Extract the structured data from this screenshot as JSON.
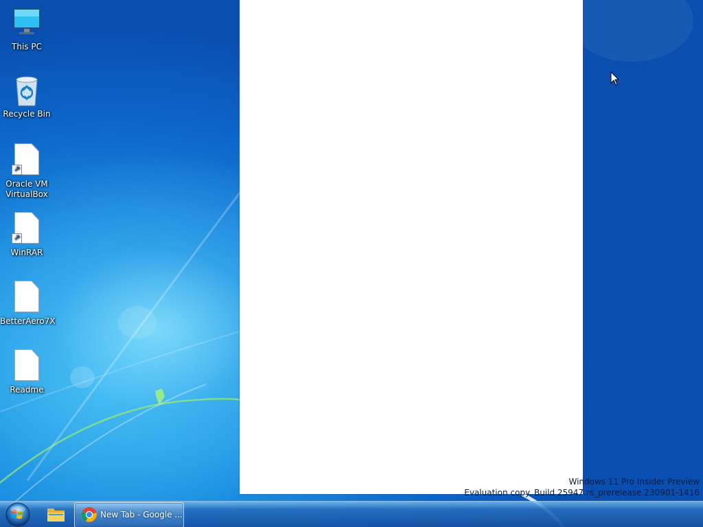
{
  "desktop": {
    "icons": [
      {
        "label": "This PC",
        "icon": "monitor-icon"
      },
      {
        "label": "Recycle Bin",
        "icon": "recycle-bin-icon"
      },
      {
        "label": "Oracle VM VirtualBox",
        "icon": "document-shortcut-icon"
      },
      {
        "label": "WinRAR",
        "icon": "document-shortcut-icon"
      },
      {
        "label": "BetterAero7X",
        "icon": "document-icon"
      },
      {
        "label": "Readme",
        "icon": "document-icon"
      }
    ],
    "watermark": {
      "line1": "Windows 11 Pro Insider Preview",
      "line2": "Evaluation copy. Build 25947.rs_prerelease.230901-1416"
    }
  },
  "taskbar": {
    "start_icon": "windows-orb-icon",
    "pinned": [
      {
        "name": "File Explorer",
        "icon": "folder-icon"
      }
    ],
    "windows": [
      {
        "label": "New Tab - Google ...",
        "icon": "chrome-icon",
        "active": true
      }
    ]
  },
  "colors": {
    "desktop_blue": "#0c64c8",
    "taskbar_blue": "#1a5aa8",
    "window_bg": "#ffffff"
  }
}
